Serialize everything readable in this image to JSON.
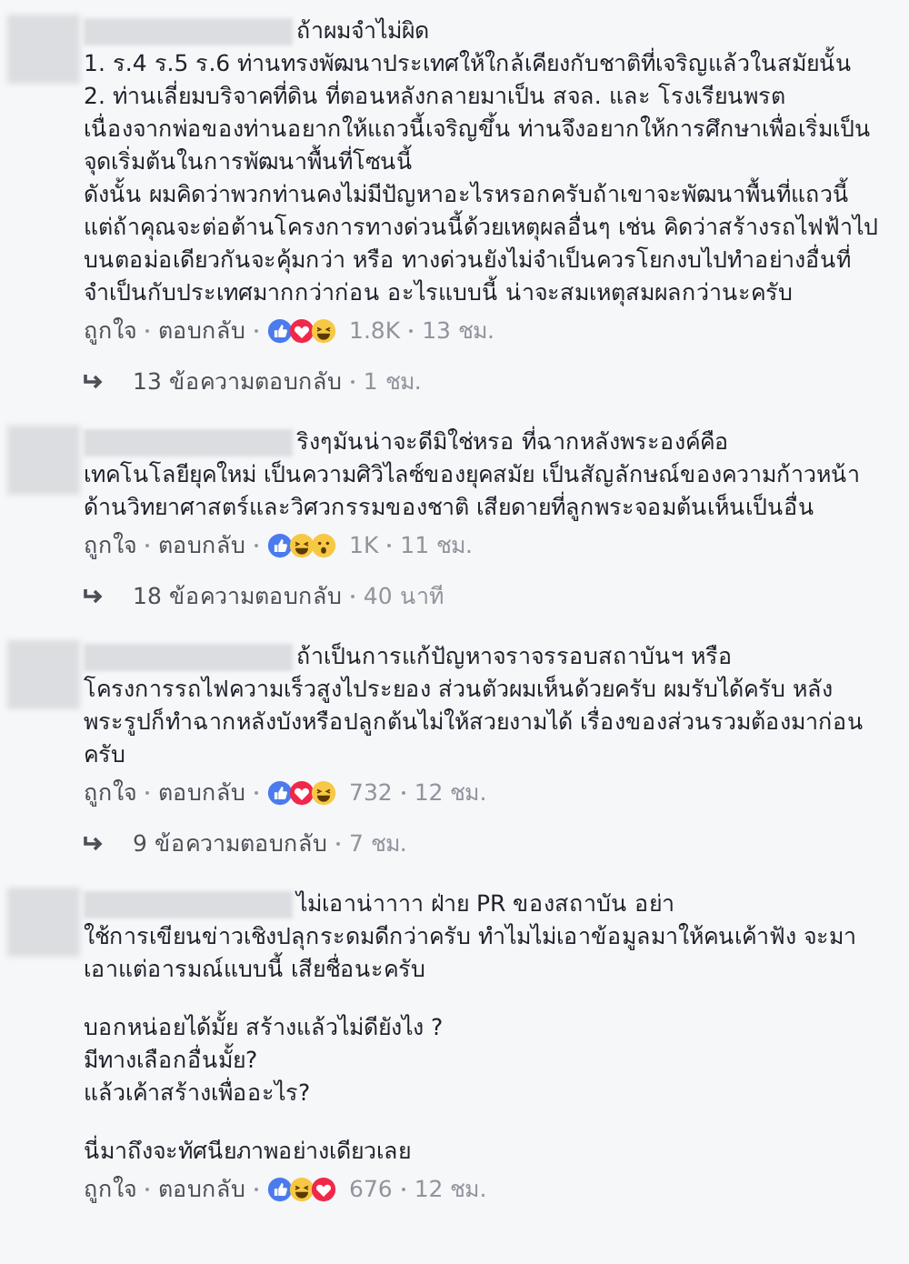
{
  "comments": [
    {
      "blocks": [
        [
          "ถ้าผมจำไม่ผิด",
          "1. ร.4 ร.5 ร.6 ท่านทรงพัฒนาประเทศให้ใกล้เคียงกับชาติที่เจริญแล้วในสมัยนั้น",
          "2. ท่านเลี่ยมบริจาคที่ดิน ที่ตอนหลังกลายมาเป็น สจล. และ โรงเรียนพรต เนื่องจากพ่อของท่านอยากให้แถวนี้เจริญขึ้น ท่านจึงอยากให้การศึกษาเพื่อเริ่มเป็นจุดเริ่มต้นในการพัฒนาพื้นที่โซนนี้",
          "ดังนั้น ผมคิดว่าพวกท่านคงไม่มีปัญหาอะไรหรอกครับถ้าเขาจะพัฒนาพื้นที่แถวนี้ แต่ถ้าคุณจะต่อต้านโครงการทางด่วนนี้ด้วยเหตุผลอื่นๆ เช่น คิดว่าสร้างรถไฟฟ้าไปบนตอม่อเดียวกันจะคุ้มกว่า หรือ ทางด่วนยังไม่จำเป็นควรโยกงบไปทำอย่างอื่นที่จำเป็นกับประเทศมากกว่าก่อน อะไรแบบนี้ น่าจะสมเหตุสมผลกว่านะครับ"
        ]
      ],
      "like_label": "ถูกใจ",
      "reply_label": "ตอบกลับ",
      "reactions": [
        {
          "kind": "like"
        },
        {
          "kind": "love"
        },
        {
          "kind": "haha"
        }
      ],
      "count": "1.8K",
      "time": "13 ชม.",
      "replies": {
        "label": "13 ข้อความตอบกลับ",
        "time": "1 ชม."
      }
    },
    {
      "blocks": [
        [
          "ริงๆมันน่าจะดีมิใช่หรอ ที่ฉากหลังพระองค์คือ",
          "เทคโนโลยียุคใหม่ เป็นความศิวิไลซ์ของยุคสมัย เป็นสัญลักษณ์ของความก้าวหน้าด้านวิทยาศาสตร์และวิศวกรรมของชาติ เสียดายที่ลูกพระจอมต้นเห็นเป็นอื่น"
        ]
      ],
      "like_label": "ถูกใจ",
      "reply_label": "ตอบกลับ",
      "reactions": [
        {
          "kind": "like"
        },
        {
          "kind": "haha"
        },
        {
          "kind": "wow"
        }
      ],
      "count": "1K",
      "time": "11 ชม.",
      "replies": {
        "label": "18 ข้อความตอบกลับ",
        "time": "40 นาที"
      }
    },
    {
      "blocks": [
        [
          "ถ้าเป็นการแก้ปัญหาจราจรรอบสถาบันฯ หรือ",
          "โครงการรถไฟความเร็วสูงไประยอง ส่วนตัวผมเห็นด้วยครับ ผมรับได้ครับ หลังพระรูปก็ทำฉากหลังบังหรือปลูกต้นไม่ให้สวยงามได้ เรื่องของส่วนรวมต้องมาก่อนครับ"
        ]
      ],
      "like_label": "ถูกใจ",
      "reply_label": "ตอบกลับ",
      "reactions": [
        {
          "kind": "like"
        },
        {
          "kind": "love"
        },
        {
          "kind": "haha"
        }
      ],
      "count": "732",
      "time": "12 ชม.",
      "replies": {
        "label": "9 ข้อความตอบกลับ",
        "time": "7 ชม."
      }
    },
    {
      "blocks": [
        [
          "ไม่เอาน่าาาา ฝ่าย PR ของสถาบัน อย่า",
          "ใช้การเขียนข่าวเชิงปลุกระดมดีกว่าครับ ทำไมไม่เอาข้อมูลมาให้คนเค้าฟัง จะมาเอาแต่อารมณ์แบบนี้ เสียชื่อนะครับ"
        ],
        [
          "บอกหน่อยได้มั้ย สร้างแล้วไม่ดียังไง ?",
          "มีทางเลือกอื่นมั้ย?",
          "แล้วเค้าสร้างเพื่ออะไร?"
        ],
        [
          "นี่มาถึงจะทัศนียภาพอย่างเดียวเลย"
        ]
      ],
      "like_label": "ถูกใจ",
      "reply_label": "ตอบกลับ",
      "reactions": [
        {
          "kind": "like"
        },
        {
          "kind": "haha"
        },
        {
          "kind": "love"
        }
      ],
      "count": "676",
      "time": "12 ชม."
    }
  ]
}
